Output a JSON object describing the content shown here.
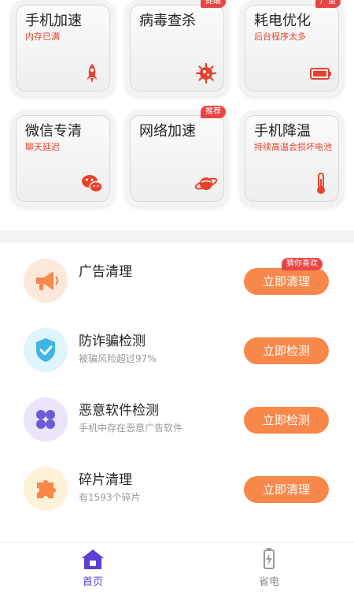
{
  "grid": [
    {
      "title": "手机加速",
      "sub": "内存已满",
      "badge": "",
      "icon": "rocket-icon"
    },
    {
      "title": "病毒查杀",
      "sub": "",
      "badge": "提醒",
      "icon": "virus-icon"
    },
    {
      "title": "耗电优化",
      "sub": "后台程序太多",
      "badge": "严重",
      "icon": "battery-icon"
    },
    {
      "title": "微信专清",
      "sub": "聊天延迟",
      "badge": "",
      "icon": "wechat-icon"
    },
    {
      "title": "网络加速",
      "sub": "",
      "badge": "推荐",
      "icon": "planet-icon"
    },
    {
      "title": "手机降温",
      "sub": "持续高温会损坏电池",
      "badge": "",
      "icon": "thermometer-icon"
    }
  ],
  "list": [
    {
      "title": "广告清理",
      "sub": "",
      "button": "立即清理",
      "tag": "猜你喜欢",
      "icon": "megaphone-icon"
    },
    {
      "title": "防诈骗检测",
      "sub": "被骗风险超过97%",
      "button": "立即检测",
      "tag": "",
      "icon": "shield-icon"
    },
    {
      "title": "恶意软件检测",
      "sub": "手机中存在恶意广告软件",
      "button": "立即检测",
      "tag": "",
      "icon": "clover-icon"
    },
    {
      "title": "碎片清理",
      "sub": "有1593个碎片",
      "button": "立即清理",
      "tag": "",
      "icon": "puzzle-icon"
    }
  ],
  "tabs": [
    {
      "label": "首页",
      "icon": "home-icon",
      "active": true
    },
    {
      "label": "省电",
      "icon": "battery-charge-icon",
      "active": false
    }
  ],
  "colors": {
    "accent": "#f8874a",
    "alert": "#e84545",
    "active_tab": "#5b3fd6"
  }
}
